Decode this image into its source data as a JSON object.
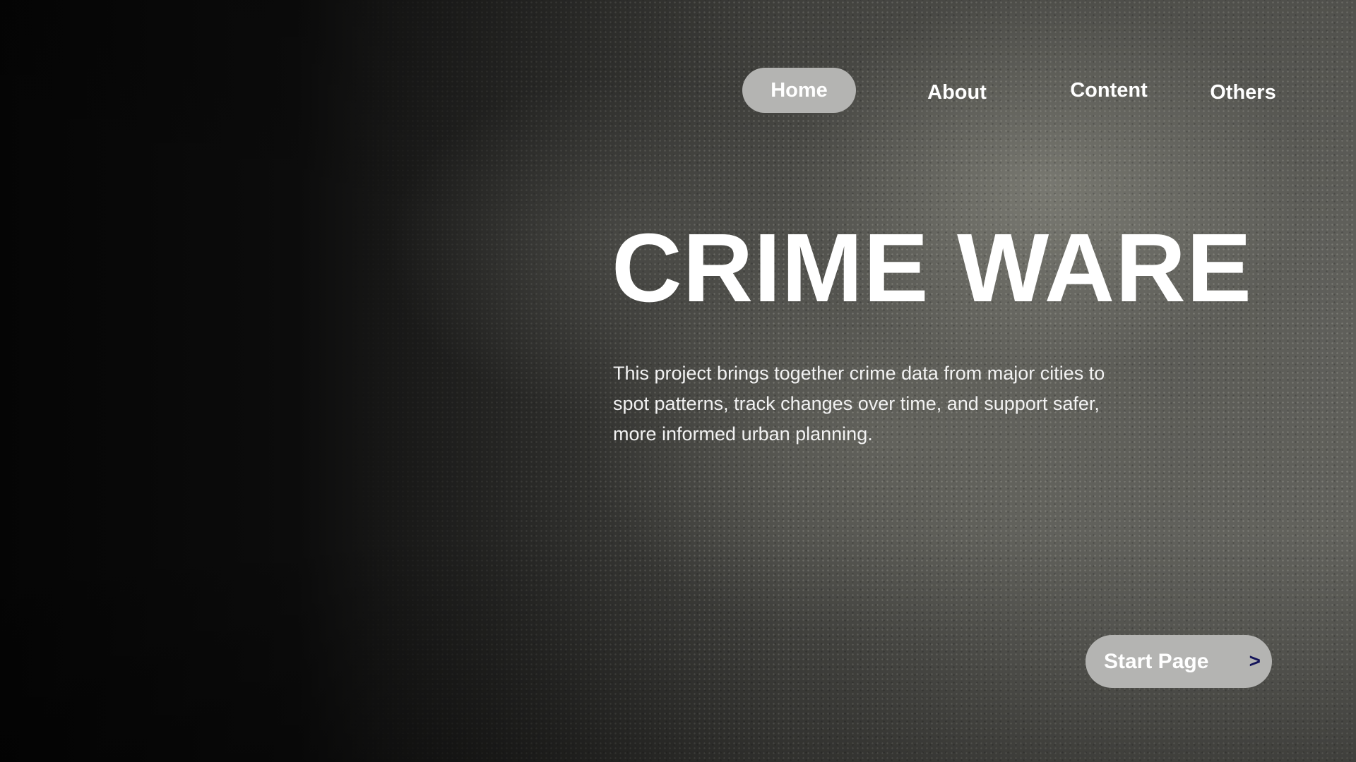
{
  "nav": {
    "items": [
      {
        "label": "Home",
        "active": true
      },
      {
        "label": "About",
        "active": false
      },
      {
        "label": "Content",
        "active": false
      },
      {
        "label": "Others",
        "active": false
      }
    ]
  },
  "hero": {
    "title": "CRIME WARE",
    "description": "This project brings together crime data from major cities to spot patterns, track changes over time, and support safer, more informed urban planning."
  },
  "cta": {
    "label": "Start Page",
    "arrow": ">"
  },
  "colors": {
    "pill_background": "#b4b4b2",
    "text": "#ffffff",
    "arrow": "#14145a",
    "background_dark": "#050505",
    "background_texture": "#5f5f5a"
  },
  "icons": {
    "cta_arrow": "chevron-right-icon"
  }
}
